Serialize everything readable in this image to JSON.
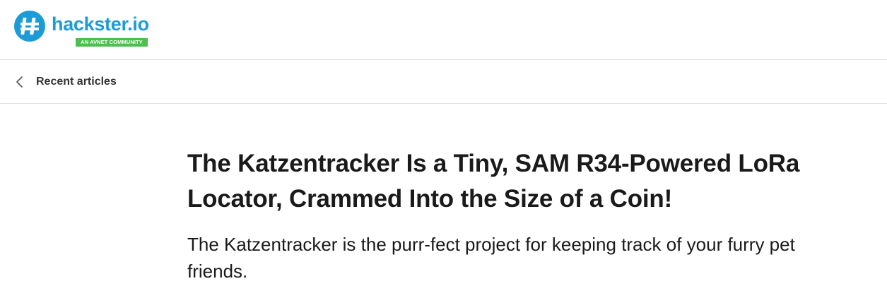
{
  "header": {
    "logo": {
      "wordmark": "hackster.io",
      "tagline": "AN AVNET COMMUNITY",
      "icon": "hackster-logo-icon"
    }
  },
  "breadcrumb": {
    "back_icon": "chevron-left-icon",
    "back_label": "Recent articles"
  },
  "article": {
    "title": "The Katzentracker Is a Tiny, SAM R34-Powered LoRa Locator, Crammed Into the Size of a Coin!",
    "subtitle": "The Katzentracker is the purr-fect project for keeping track of your furry pet friends."
  },
  "colors": {
    "brand_blue": "#1d9bd7",
    "tagline_green": "#4cbf4f",
    "divider": "#e0e0e0",
    "text": "#1a1a1a"
  }
}
